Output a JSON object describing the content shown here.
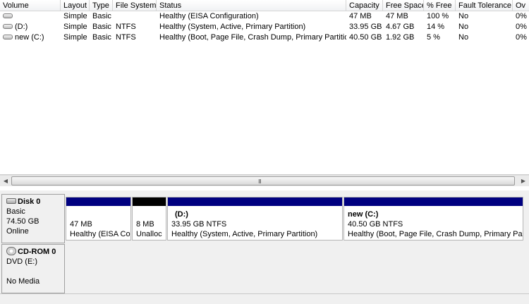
{
  "columns": [
    "Volume",
    "Layout",
    "Type",
    "File System",
    "Status",
    "Capacity",
    "Free Space",
    "% Free",
    "Fault Tolerance",
    "Ov"
  ],
  "rows": [
    {
      "volume": "",
      "layout": "Simple",
      "type": "Basic",
      "fs": "",
      "status": "Healthy (EISA Configuration)",
      "capacity": "47 MB",
      "free": "47 MB",
      "pct": "100 %",
      "fault": "No",
      "ov": "0%"
    },
    {
      "volume": "(D:)",
      "layout": "Simple",
      "type": "Basic",
      "fs": "NTFS",
      "status": "Healthy (System, Active, Primary Partition)",
      "capacity": "33.95 GB",
      "free": "4.67 GB",
      "pct": "14 %",
      "fault": "No",
      "ov": "0%"
    },
    {
      "volume": "new (C:)",
      "layout": "Simple",
      "type": "Basic",
      "fs": "NTFS",
      "status": "Healthy (Boot, Page File, Crash Dump, Primary Partition)",
      "capacity": "40.50 GB",
      "free": "1.92 GB",
      "pct": "5 %",
      "fault": "No",
      "ov": "0%"
    }
  ],
  "scrollbar": {
    "left_arrow": "◀",
    "right_arrow": "▶",
    "grip": "III"
  },
  "disk0": {
    "title": "Disk 0",
    "type": "Basic",
    "size": "74.50 GB",
    "status": "Online",
    "partitions": [
      {
        "name": "",
        "size": "47 MB",
        "status": "Healthy (EISA Co",
        "bar_color": "#000080"
      },
      {
        "name": "",
        "size": "8 MB",
        "status": "Unalloc",
        "bar_color": "#000000"
      },
      {
        "name": "(D:)",
        "size": "33.95 GB NTFS",
        "status": "Healthy (System, Active, Primary Partition)",
        "bar_color": "#000080"
      },
      {
        "name": "new  (C:)",
        "size": "40.50 GB NTFS",
        "status": "Healthy (Boot, Page File, Crash Dump, Primary Partit",
        "bar_color": "#000080"
      }
    ]
  },
  "cdrom0": {
    "title": "CD-ROM 0",
    "drive": "DVD (E:)",
    "status": "No Media"
  }
}
